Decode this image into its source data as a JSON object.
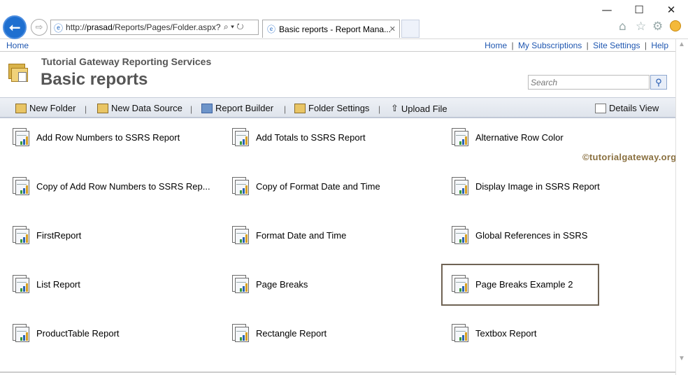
{
  "browser": {
    "address_prefix": "http://",
    "address_host": "prasad",
    "address_path": "/Reports/Pages/Folder.aspx?",
    "address_tools": "⌕ ▾ ↻",
    "tab_title": "Basic reports - Report Mana...",
    "tab_close": "✕",
    "back_glyph": "⭠",
    "forward_glyph": "⇨",
    "minimize": "—",
    "maximize": "☐",
    "close": "✕"
  },
  "topbar": {
    "home": "Home",
    "links": [
      "Home",
      "My Subscriptions",
      "Site Settings",
      "Help"
    ],
    "separator": "|"
  },
  "header": {
    "site_name": "Tutorial Gateway Reporting Services",
    "title": "Basic reports",
    "search_placeholder": "Search"
  },
  "toolbar": {
    "new_folder": "New Folder",
    "new_data_source": "New Data Source",
    "report_builder": "Report Builder",
    "folder_settings": "Folder Settings",
    "upload_file": "Upload File",
    "details_view": "Details View",
    "separator": "|"
  },
  "reports": [
    "Add Row Numbers to SSRS Report",
    "Add Totals to SSRS Report",
    "Alternative Row Color",
    "Copy of Add Row Numbers to SSRS Rep...",
    "Copy of Format Date and Time",
    "Display Image in SSRS Report",
    "FirstReport",
    "Format Date and Time",
    "Global References in SSRS",
    "List Report",
    "Page Breaks",
    "Page Breaks Example 2",
    "ProductTable Report",
    "Rectangle Report",
    "Textbox Report"
  ],
  "selected_report": "Page Breaks Example 2",
  "watermark": "©tutorialgateway.org",
  "colors": {
    "link": "#1e56b0",
    "title_gray": "#555555",
    "selection_border": "#6f6354",
    "back_button": "#1e6fd0"
  }
}
